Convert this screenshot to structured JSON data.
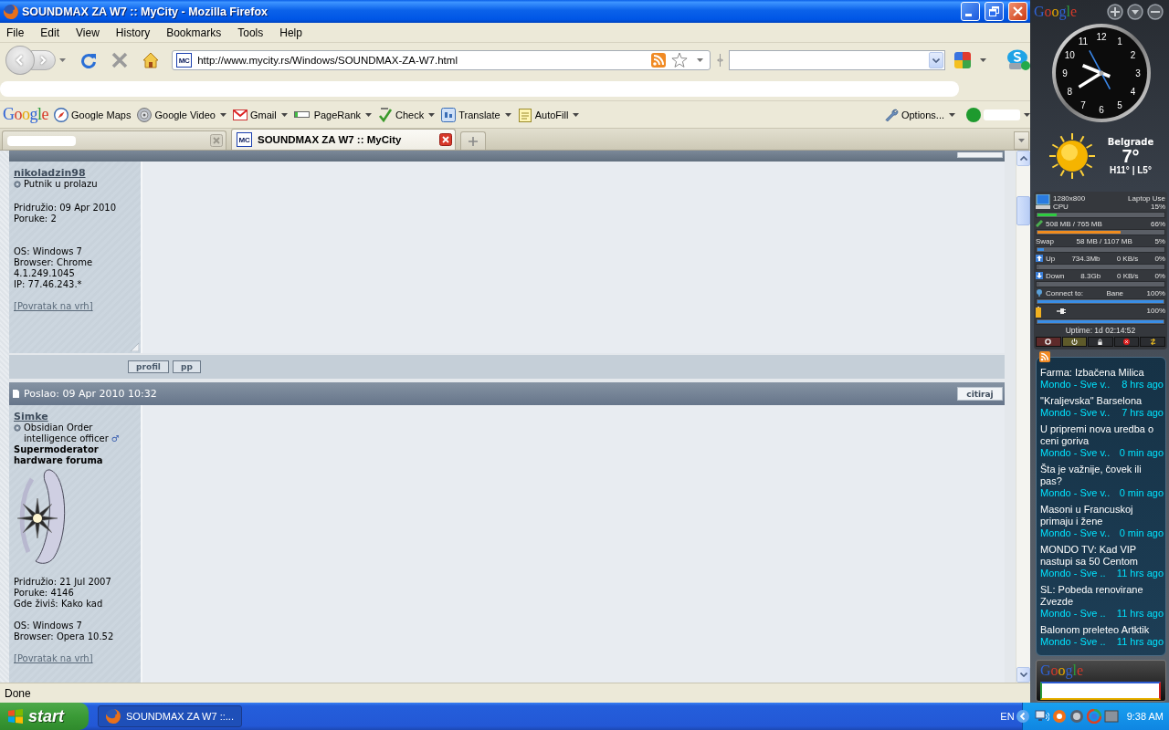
{
  "window": {
    "title": "SOUNDMAX ZA W7 :: MyCity - Mozilla Firefox"
  },
  "menu": [
    "File",
    "Edit",
    "View",
    "History",
    "Bookmarks",
    "Tools",
    "Help"
  ],
  "navigation": {
    "favicon": "MC",
    "url": "http://www.mycity.rs/Windows/SOUNDMAX-ZA-W7.html"
  },
  "google_toolbar": {
    "logo": "Google",
    "items": [
      {
        "label": "Google Maps",
        "dropdown": false
      },
      {
        "label": "Google Video",
        "dropdown": true
      },
      {
        "label": "Gmail",
        "dropdown": true
      },
      {
        "label": "PageRank",
        "dropdown": true
      },
      {
        "label": "Check",
        "dropdown": true
      },
      {
        "label": "Translate",
        "dropdown": true
      },
      {
        "label": "AutoFill",
        "dropdown": true
      }
    ],
    "options": {
      "label": "Options...",
      "dropdown": true
    }
  },
  "tabs": [
    {
      "selected": false
    },
    {
      "favicon": "MC",
      "label": "SOUNDMAX ZA W7 :: MyCity",
      "selected": true
    }
  ],
  "page": {
    "header_edge_visible": true,
    "posts": [
      {
        "author": {
          "name": "nikoladzin98",
          "rank": "Putnik u prolazu",
          "details": [
            "Pridružio: 09 Apr 2010",
            "Poruke: 2"
          ],
          "system": [
            "OS: Windows 7",
            "Browser: Chrome 4.1.249.1045",
            "IP: 77.46.243.*"
          ],
          "back_link": "[Povratak na vrh]"
        },
        "buttons": [
          "profil",
          "pp"
        ]
      },
      {
        "header": {
          "posted": "Poslao: 09 Apr 2010 10:32",
          "quote": "citiraj"
        },
        "author": {
          "name": "Simke",
          "rank": "Obsidian Order intelligence officer",
          "gender": "♂",
          "staff_title": "Supermoderator hardware foruma",
          "avatar": true,
          "details": [
            "Pridružio: 21 Jul 2007",
            "Poruke: 4146",
            "Gde živiš: Kako kad"
          ],
          "system": [
            "OS: Windows 7",
            "Browser: Opera 10.52"
          ],
          "back_link": "[Povratak na vrh]"
        }
      }
    ]
  },
  "status_bar": {
    "text": "Done"
  },
  "sidebar": {
    "logo": "Google",
    "clock": {
      "numerals": [
        "12",
        "1",
        "2",
        "3",
        "4",
        "5",
        "6",
        "7",
        "8",
        "9",
        "10",
        "11"
      ]
    },
    "weather": {
      "city": "Belgrade",
      "temperature": "7°",
      "range": "H11° | L5°"
    },
    "system_monitor": {
      "rows": [
        {
          "kind": "cpu",
          "lines": [
            [
              "1280x800",
              "Laptop Use"
            ],
            [
              "CPU",
              "15%"
            ]
          ],
          "level": 0.15,
          "color": "#2ecc40"
        },
        {
          "kind": "memory",
          "lines": [
            [
              "508 MB / 765 MB",
              "66%"
            ]
          ],
          "level": 0.66,
          "color": "#f08c1e"
        },
        {
          "kind": "swap",
          "lines": [
            [
              "Swap",
              "58 MB / 1107 MB",
              "5%"
            ]
          ],
          "level": 0.05,
          "color": "#3a8ee6"
        },
        {
          "kind": "upload",
          "lines": [
            [
              "Up",
              "734.3Mb",
              "0 KB/s",
              "0%"
            ]
          ],
          "level": 0
        },
        {
          "kind": "download",
          "lines": [
            [
              "Down",
              "8.3Gb",
              "0 KB/s",
              "0%"
            ]
          ],
          "level": 0
        },
        {
          "kind": "network",
          "lines": [
            [
              "Connect to:",
              "Bane",
              "100%"
            ]
          ],
          "level": 1,
          "color": "#3a8ee6"
        },
        {
          "kind": "battery",
          "lines": [
            [
              "100%"
            ]
          ],
          "level": 1,
          "color": "#3a8ee6"
        }
      ],
      "uptime": "Uptime: 1d 02:14:52"
    },
    "news": [
      {
        "title_lines": [
          "Farma: Izbačena Milica"
        ],
        "source": "Mondo - Sve v..",
        "time": "8 hrs ago"
      },
      {
        "title_lines": [
          "\"Kraljevska\" Barselona"
        ],
        "source": "Mondo - Sve v..",
        "time": "7 hrs ago"
      },
      {
        "title_lines": [
          "U pripremi nova uredba o",
          "ceni goriva"
        ],
        "source": "Mondo - Sve v..",
        "time": "0 min ago"
      },
      {
        "title_lines": [
          "Šta je važnije, čovek ili",
          "pas?"
        ],
        "source": "Mondo - Sve v..",
        "time": "0 min ago"
      },
      {
        "title_lines": [
          "Masoni u Francuskoj",
          "primaju i žene"
        ],
        "source": "Mondo - Sve v..",
        "time": "0 min ago"
      },
      {
        "title_lines": [
          "MONDO TV: Kad VIP",
          "nastupi sa 50 Centom"
        ],
        "source": "Mondo - Sve ..",
        "time": "11 hrs ago"
      },
      {
        "title_lines": [
          "SL: Pobeda renovirane",
          "Zvezde"
        ],
        "source": "Mondo - Sve ..",
        "time": "11 hrs ago"
      },
      {
        "title_lines": [
          "Balonom preleteo Artktik"
        ],
        "source": "Mondo - Sve ..",
        "time": "11 hrs ago"
      }
    ],
    "search": {
      "logo": "Google"
    }
  },
  "taskbar": {
    "start": "start",
    "tasks": [
      {
        "label": "SOUNDMAX ZA W7 ::...",
        "selected": true
      }
    ],
    "language": "EN",
    "time": "9:38 AM"
  }
}
